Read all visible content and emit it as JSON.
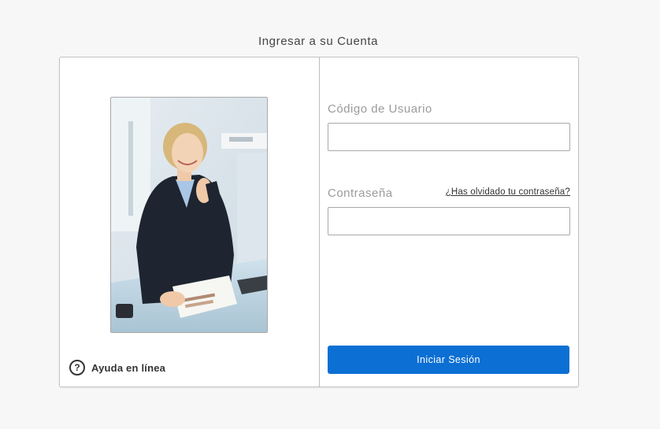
{
  "page": {
    "title": "Ingresar a su Cuenta"
  },
  "help": {
    "icon": "question-circle-icon",
    "label": "Ayuda en línea"
  },
  "login_form": {
    "username_label": "Código de Usuario",
    "username_value": "",
    "password_label": "Contraseña",
    "password_value": "",
    "forgot_password_link": "¿Has olvidado tu contraseña?",
    "submit_label": "Iniciar Sesión"
  },
  "colors": {
    "primary_button": "#0b6fd3",
    "label_gray": "#9b9b9b",
    "border": "#a9a9a9"
  }
}
